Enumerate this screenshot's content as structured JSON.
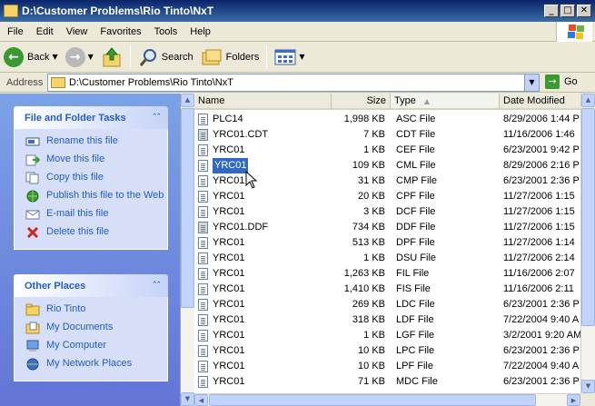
{
  "window": {
    "title": "D:\\Customer Problems\\Rio Tinto\\NxT",
    "buttons": [
      "_",
      "□",
      "✕"
    ]
  },
  "menu": [
    "File",
    "Edit",
    "View",
    "Favorites",
    "Tools",
    "Help"
  ],
  "toolbar": {
    "back_label": "Back",
    "search_label": "Search",
    "folders_label": "Folders"
  },
  "address": {
    "label": "Address",
    "path": "D:\\Customer Problems\\Rio Tinto\\NxT",
    "go_label": "Go"
  },
  "tasks": {
    "title": "File and Folder Tasks",
    "items": [
      {
        "label": "Rename this file",
        "icon": "rename-icon"
      },
      {
        "label": "Move this file",
        "icon": "move-icon"
      },
      {
        "label": "Copy this file",
        "icon": "copy-icon"
      },
      {
        "label": "Publish this file to the Web",
        "icon": "publish-icon"
      },
      {
        "label": "E-mail this file",
        "icon": "email-icon"
      },
      {
        "label": "Delete this file",
        "icon": "delete-icon"
      }
    ]
  },
  "places": {
    "title": "Other Places",
    "items": [
      {
        "label": "Rio Tinto",
        "icon": "folder-icon"
      },
      {
        "label": "My Documents",
        "icon": "my-documents-icon"
      },
      {
        "label": "My Computer",
        "icon": "my-computer-icon"
      },
      {
        "label": "My Network Places",
        "icon": "network-places-icon"
      }
    ]
  },
  "columns": {
    "name": "Name",
    "size": "Size",
    "type": "Type",
    "modified": "Date Modified",
    "sorted_by": "Type"
  },
  "files": [
    {
      "name": "PLC14",
      "size": "1,998 KB",
      "type": "ASC File",
      "modified": "8/29/2006 1:44 P",
      "sys": false
    },
    {
      "name": "YRC01.CDT",
      "size": "7 KB",
      "type": "CDT File",
      "modified": "11/16/2006 1:46",
      "sys": true
    },
    {
      "name": "YRC01",
      "size": "1 KB",
      "type": "CEF File",
      "modified": "6/23/2001 9:42 P",
      "sys": false
    },
    {
      "name": "YRC01",
      "size": "109 KB",
      "type": "CML File",
      "modified": "8/29/2006 2:16 P",
      "sys": false,
      "selected": true
    },
    {
      "name": "YRC01",
      "size": "31 KB",
      "type": "CMP File",
      "modified": "6/23/2001 2:36 P",
      "sys": false
    },
    {
      "name": "YRC01",
      "size": "20 KB",
      "type": "CPF File",
      "modified": "11/27/2006 1:15",
      "sys": false
    },
    {
      "name": "YRC01",
      "size": "3 KB",
      "type": "DCF File",
      "modified": "11/27/2006 1:15",
      "sys": false
    },
    {
      "name": "YRC01.DDF",
      "size": "734 KB",
      "type": "DDF File",
      "modified": "11/27/2006 1:15",
      "sys": true
    },
    {
      "name": "YRC01",
      "size": "513 KB",
      "type": "DPF File",
      "modified": "11/27/2006 1:14",
      "sys": false
    },
    {
      "name": "YRC01",
      "size": "1 KB",
      "type": "DSU File",
      "modified": "11/27/2006 2:14",
      "sys": false
    },
    {
      "name": "YRC01",
      "size": "1,263 KB",
      "type": "FIL File",
      "modified": "11/16/2006 2:07",
      "sys": false
    },
    {
      "name": "YRC01",
      "size": "1,410 KB",
      "type": "FIS File",
      "modified": "11/16/2006 2:11",
      "sys": false
    },
    {
      "name": "YRC01",
      "size": "269 KB",
      "type": "LDC File",
      "modified": "6/23/2001 2:36 P",
      "sys": false
    },
    {
      "name": "YRC01",
      "size": "318 KB",
      "type": "LDF File",
      "modified": "7/22/2004 9:40 A",
      "sys": false
    },
    {
      "name": "YRC01",
      "size": "1 KB",
      "type": "LGF File",
      "modified": "3/2/2001 9:20 AM",
      "sys": false
    },
    {
      "name": "YRC01",
      "size": "10 KB",
      "type": "LPC File",
      "modified": "6/23/2001 2:36 P",
      "sys": false
    },
    {
      "name": "YRC01",
      "size": "10 KB",
      "type": "LPF File",
      "modified": "7/22/2004 9:40 A",
      "sys": false
    },
    {
      "name": "YRC01",
      "size": "71 KB",
      "type": "MDC File",
      "modified": "6/23/2001 2:36 P",
      "sys": false
    }
  ]
}
